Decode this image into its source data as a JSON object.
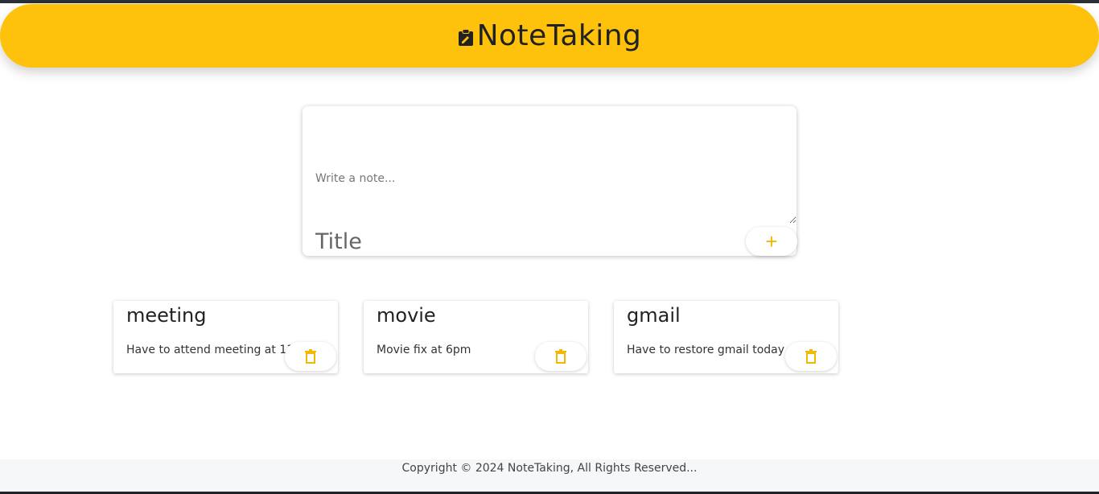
{
  "header": {
    "title": "NoteTaking",
    "icon": "clipboard-edit-icon",
    "accent_color": "#fec20c"
  },
  "composer": {
    "title_placeholder": "Title",
    "note_placeholder": "Write a note...",
    "add_icon": "plus-icon"
  },
  "notes": [
    {
      "title": "meeting",
      "content": "Have to attend meeting at 11",
      "delete_icon": "trash-icon"
    },
    {
      "title": "movie",
      "content": "Movie fix at 6pm",
      "delete_icon": "trash-icon"
    },
    {
      "title": "gmail",
      "content": "Have to restore gmail today",
      "delete_icon": "trash-icon"
    }
  ],
  "footer": {
    "text": "Copyright © 2024 NoteTaking, All Rights Reserved..."
  }
}
